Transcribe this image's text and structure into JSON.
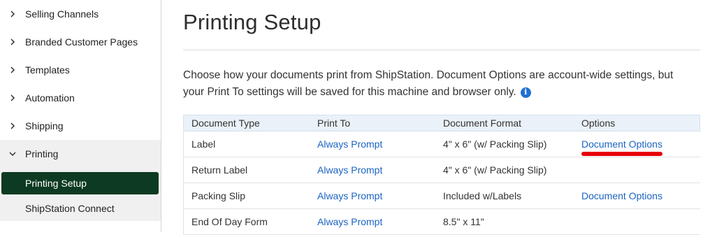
{
  "sidebar": {
    "items": [
      {
        "label": "Selling Channels"
      },
      {
        "label": "Branded Customer Pages"
      },
      {
        "label": "Templates"
      },
      {
        "label": "Automation"
      },
      {
        "label": "Shipping"
      },
      {
        "label": "Printing"
      }
    ],
    "sub_items": [
      {
        "label": "Printing Setup"
      },
      {
        "label": "ShipStation Connect"
      }
    ]
  },
  "main": {
    "title": "Printing Setup",
    "description": "Choose how your documents print from ShipStation. Document Options are account-wide settings, but your Print To settings will be saved for this machine and browser only.",
    "table": {
      "headers": [
        "Document Type",
        "Print To",
        "Document Format",
        "Options"
      ],
      "rows": [
        {
          "type": "Label",
          "print_to": "Always Prompt",
          "format": "4\" x 6\" (w/ Packing Slip)",
          "options": "Document Options"
        },
        {
          "type": "Return Label",
          "print_to": "Always Prompt",
          "format": "4\" x 6\" (w/ Packing Slip)",
          "options": ""
        },
        {
          "type": "Packing Slip",
          "print_to": "Always Prompt",
          "format": "Included w/Labels",
          "options": "Document Options"
        },
        {
          "type": "End Of Day Form",
          "print_to": "Always Prompt",
          "format": "8.5\" x 11\"",
          "options": ""
        }
      ]
    }
  },
  "colors": {
    "accent_active": "#0d3a22",
    "link": "#1b64c2",
    "info_icon": "#1f6fd1",
    "annotation_mark": "#e8000b"
  },
  "icons": {
    "collapsed": "chevron-right-icon",
    "expanded": "chevron-down-icon",
    "info": "info-icon"
  }
}
